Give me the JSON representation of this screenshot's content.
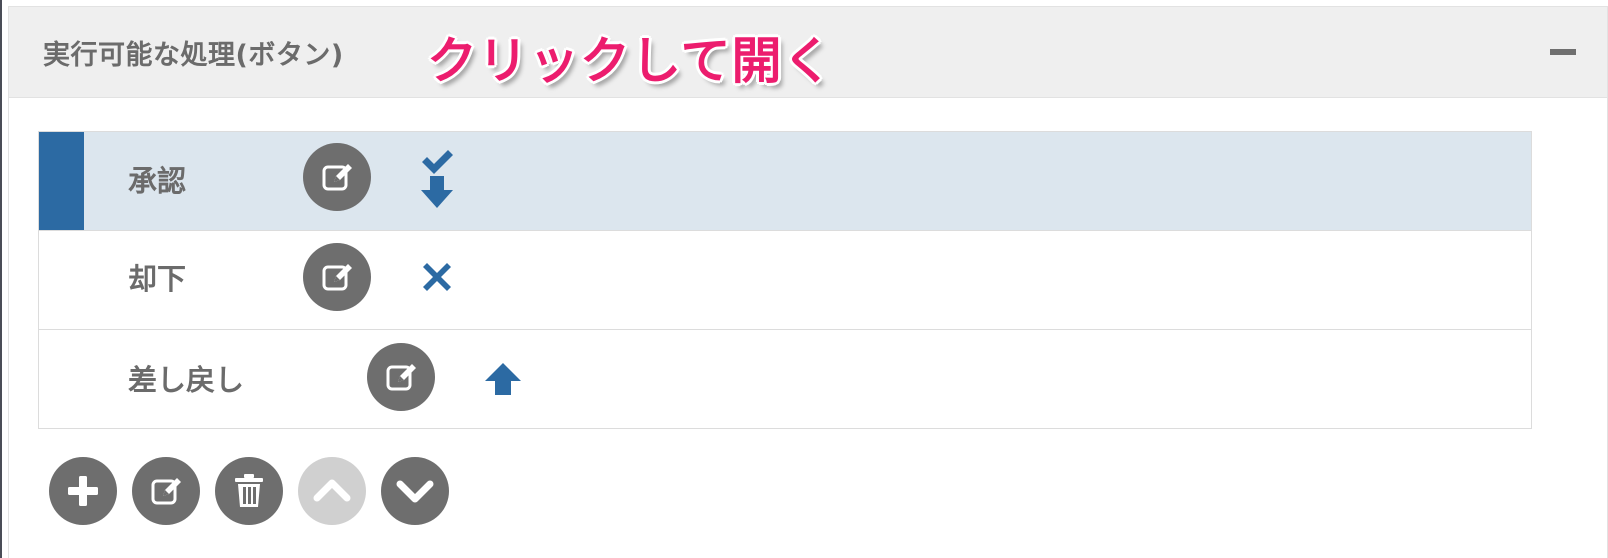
{
  "panel": {
    "title": "実行可能な処理(ボタン)",
    "annotation": "クリックして開く",
    "collapse_icon": "minus-icon"
  },
  "actions": [
    {
      "label": "承認",
      "selected": true,
      "edit_icon": "edit-icon",
      "action_icon": "check-down-arrow-icon"
    },
    {
      "label": "却下",
      "selected": false,
      "edit_icon": "edit-icon",
      "action_icon": "cross-icon"
    },
    {
      "label": "差し戻し",
      "selected": false,
      "edit_icon": "edit-icon",
      "action_icon": "up-arrow-icon"
    }
  ],
  "toolbar": {
    "buttons": [
      {
        "icon": "plus-icon",
        "enabled": true
      },
      {
        "icon": "edit-icon",
        "enabled": true
      },
      {
        "icon": "trash-icon",
        "enabled": true
      },
      {
        "icon": "chevron-up-icon",
        "enabled": false
      },
      {
        "icon": "chevron-down-icon",
        "enabled": true
      }
    ]
  },
  "colors": {
    "header_bg": "#efefef",
    "selected_row_bg": "#dce6ee",
    "selection_bar": "#2c6aa3",
    "action_icon": "#2c6aa3",
    "annotation": "#ec1d6e",
    "button_bg": "#6e6e6e",
    "button_disabled_bg": "#d0d0d0"
  }
}
